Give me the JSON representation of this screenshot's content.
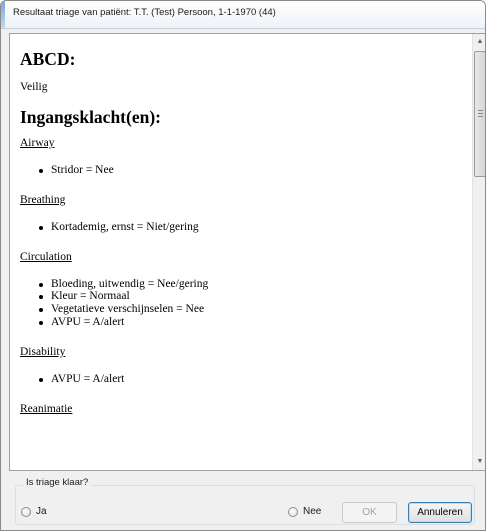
{
  "window": {
    "title": "Resultaat triage van patiënt: T.T. (Test) Persoon, 1-1-1970 (44)"
  },
  "document": {
    "heading_abcd": "ABCD:",
    "abcd_value": "Veilig",
    "heading_complaints": "Ingangsklacht(en):",
    "sections": [
      {
        "title": "Airway",
        "items": [
          "Stridor = Nee"
        ]
      },
      {
        "title": "Breathing",
        "items": [
          "Kortademig, ernst = Niet/gering"
        ]
      },
      {
        "title": "Circulation",
        "items": [
          "Bloeding, uitwendig = Nee/gering",
          "Kleur = Normaal",
          "Vegetatieve verschijnselen = Nee",
          "AVPU = A/alert"
        ]
      },
      {
        "title": "Disability",
        "items": [
          "AVPU = A/alert"
        ]
      },
      {
        "title": "Reanimatie",
        "items": []
      }
    ]
  },
  "scrollbar": {
    "up_icon": "scroll-up-arrow-icon",
    "down_icon": "scroll-down-arrow-icon"
  },
  "triage_question": {
    "label": "Is triage klaar?",
    "options": [
      "Ja",
      "Nee"
    ],
    "selected": null
  },
  "buttons": {
    "ok": "OK",
    "cancel": "Annuleren"
  },
  "colors": {
    "window_bg": "#f0f0f0",
    "focus_border": "#3c7fb1",
    "disabled_text": "#a0a0a0"
  }
}
